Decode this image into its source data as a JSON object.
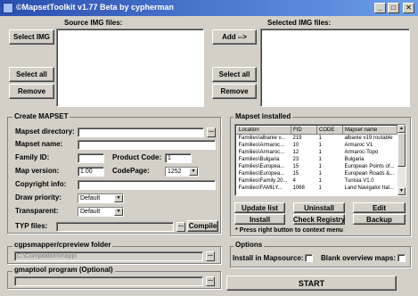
{
  "window": {
    "title": "©MapsetToolkit v1.77 Beta by cypherman"
  },
  "titlebar": {
    "minimize": "_",
    "maximize": "□",
    "close": "✕"
  },
  "source": {
    "label": "Source IMG files:",
    "select_img": "Select IMG",
    "select_all": "Select all",
    "remove": "Remove"
  },
  "selected": {
    "label": "Selected IMG files:",
    "add": "Add -->",
    "select_all": "Select all",
    "remove": "Remove"
  },
  "create_mapset": {
    "title": "Create MAPSET",
    "mapset_directory_label": "Mapset directory:",
    "mapset_directory_value": "",
    "mapset_name_label": "Mapset name:",
    "mapset_name_value": "",
    "family_id_label": "Family ID:",
    "family_id_value": "",
    "product_code_label": "Product Code:",
    "product_code_value": "1",
    "map_version_label": "Map version:",
    "map_version_value": "1.00",
    "codepage_label": "CodePage:",
    "codepage_value": "1252",
    "copyright_label": "Copyright info:",
    "copyright_value": "",
    "draw_priority_label": "Draw priority:",
    "draw_priority_value": "Default",
    "transparent_label": "Transparent:",
    "transparent_value": "Default",
    "typ_files_label": "TYP files:",
    "typ_files_value": "",
    "compile": "Compile",
    "browse": "..."
  },
  "cgpsmapper": {
    "title": "cgpsmapper/cpreview folder",
    "value": "C:\\Compilation\\mapp\\"
  },
  "gmaptool": {
    "title": "gmaptool program (Optional)",
    "value": ""
  },
  "mapset_installed": {
    "title": "Mapset installed",
    "columns": [
      "Location",
      "FID",
      "CODE",
      "Mapset name"
    ],
    "rows": [
      [
        "Families\\albanie v...",
        "219",
        "1",
        "albanie v19 routable"
      ],
      [
        "Families\\Armaroc...",
        "10",
        "1",
        "Armaroc V1"
      ],
      [
        "Families\\Armaroc...",
        "12",
        "1",
        "Armaroc-Topo"
      ],
      [
        "Families\\Bulgaria",
        "23",
        "1",
        "Bulgaria"
      ],
      [
        "Families\\Europea...",
        "15",
        "1",
        "European Points of..."
      ],
      [
        "Families\\Europea...",
        "15",
        "1",
        "European Roads &..."
      ],
      [
        "Families\\Family 20...",
        "4",
        "1",
        "Tunisia V1.0"
      ],
      [
        "Families\\FAMILY...",
        "1068",
        "1",
        "Land Navigator Ital..."
      ]
    ],
    "update_list": "Update list",
    "uninstall": "Uninstall",
    "edit": "Edit",
    "install": "Install",
    "check_registry": "Check Registry",
    "backup": "Backup",
    "note": "* Press right button to context menu"
  },
  "options": {
    "title": "Options",
    "install_in_mapsource": "Install in Mapsource:",
    "blank_overview": "Blank overview maps:"
  },
  "start": "START"
}
